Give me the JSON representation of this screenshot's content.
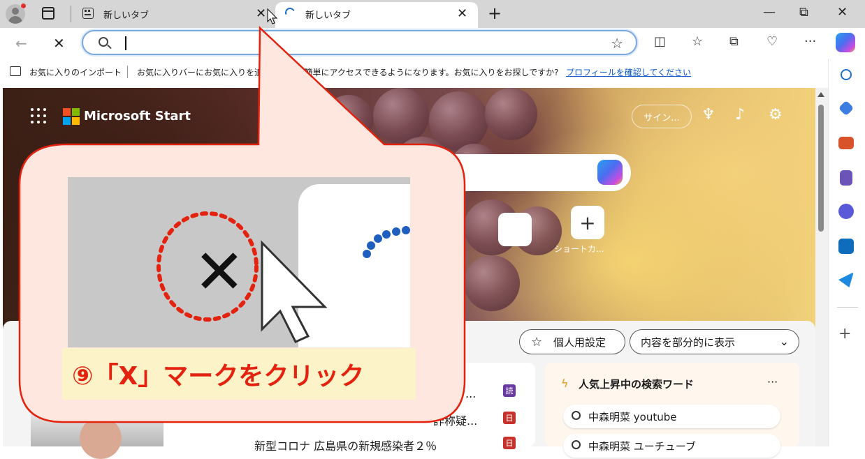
{
  "tabs": [
    {
      "title": "新しいタブ",
      "close": "✕"
    },
    {
      "title": "新しいタブ",
      "close": "✕"
    }
  ],
  "new_tab": "+",
  "window": {
    "minimize": "—",
    "restore": "⧉",
    "close": "✕"
  },
  "nav": {
    "back": "←",
    "stop": "✕",
    "more": "···"
  },
  "favorites_bar": {
    "import_label": "お気に入りのインポート",
    "message": "お気に入りバーにお気に入りを追加すると、簡単にアクセスできるようになります。お気に入りをお探しですか?",
    "link": "プロフィールを確認してください"
  },
  "start": {
    "brand": "Microsoft Start",
    "signin": "サイン...",
    "shortcut_label": "ショートカ...",
    "add": "+"
  },
  "feed": {
    "personal_settings": "個人用設定",
    "display_mode": "内容を部分的に表示",
    "news": [
      {
        "text": "シ...",
        "src": "読"
      },
      {
        "text": "詐称疑...",
        "src": "日"
      },
      {
        "text": "新型コロナ 広島県の新規感染者２％",
        "src": "日"
      }
    ],
    "trending_title": "人気上昇中の検索ワード",
    "trending_more": "···",
    "trending": [
      "中森明菜 youtube",
      "中森明菜 ユーチューブ"
    ]
  },
  "callout": {
    "caption": "⑨「X」マークをクリック",
    "zoom_x": "✕",
    "accent": "#e3220f",
    "fill": "#fde7de"
  }
}
